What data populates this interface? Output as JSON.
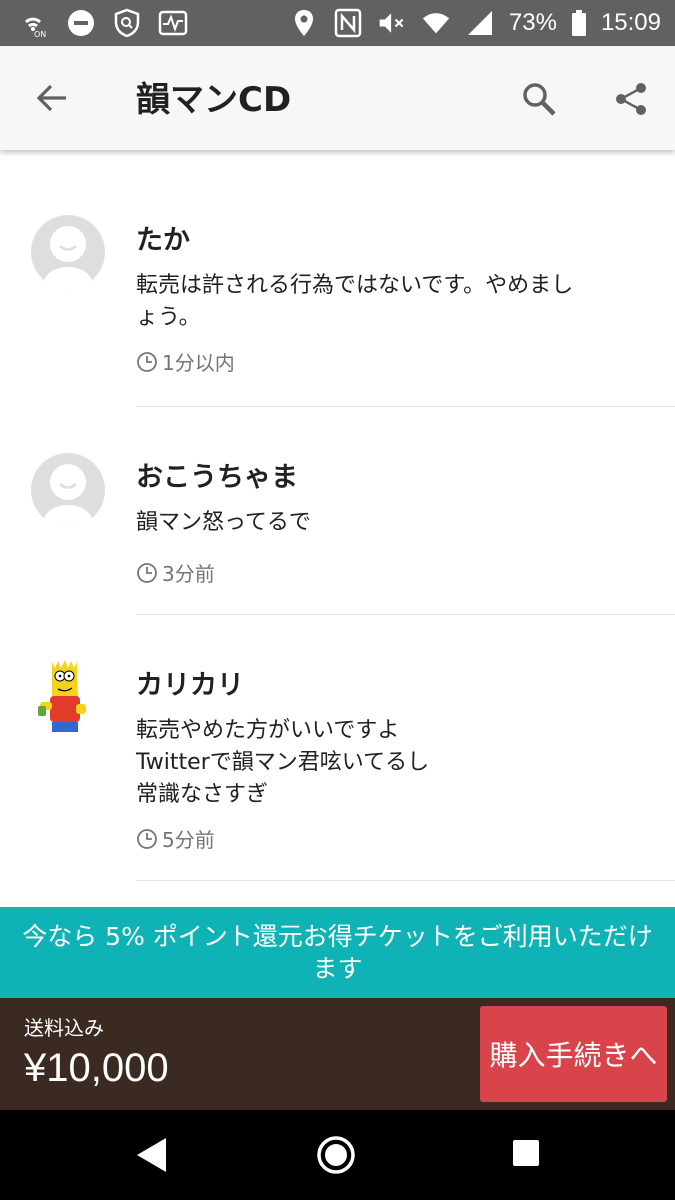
{
  "status_bar": {
    "battery": "73%",
    "time": "15:09"
  },
  "app_bar": {
    "title": "韻マンCD"
  },
  "comments": [
    {
      "name": "たか",
      "text_lines": [
        "転売は許される行為ではないです。やめまし",
        "ょう。"
      ],
      "time": "1分以内",
      "avatar": "default-avatar"
    },
    {
      "name": "おこうちゃま",
      "text_lines": [
        "韻マン怒ってるで"
      ],
      "time": "3分前",
      "avatar": "default-avatar"
    },
    {
      "name": "カリカリ",
      "text_lines": [
        "転売やめた方がいいですよ",
        "Twitterで韻マン君呟いてるし",
        "常識なさすぎ"
      ],
      "time": "5分前",
      "avatar": "cartoon-character-avatar"
    }
  ],
  "banner": {
    "text": "今なら 5% ポイント還元お得チケットをご利用いただけます",
    "color": "#10b3b5"
  },
  "purchase_bar": {
    "shipping_label": "送料込み",
    "price": "¥10,000",
    "buy_label": "購入手続きへ",
    "buy_color": "#d9434a"
  },
  "nav_icons": [
    "back-triangle-icon",
    "home-circle-icon",
    "recent-square-icon"
  ]
}
